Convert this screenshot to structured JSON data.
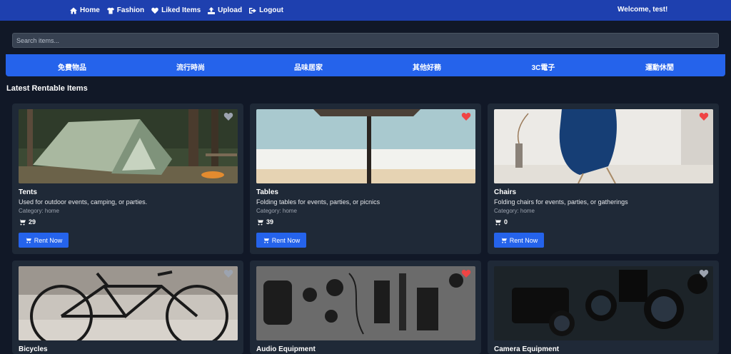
{
  "nav": {
    "links": [
      {
        "label": "Home",
        "icon": "home-icon"
      },
      {
        "label": "Fashion",
        "icon": "shirt-icon"
      },
      {
        "label": "Liked Items",
        "icon": "heart-icon"
      },
      {
        "label": "Upload",
        "icon": "upload-icon"
      },
      {
        "label": "Logout",
        "icon": "logout-icon"
      }
    ],
    "welcome": "Welcome, test!"
  },
  "search": {
    "placeholder": "Search items..."
  },
  "categories": [
    "免費物品",
    "流行時尚",
    "品味居家",
    "其他好務",
    "3C電子",
    "運動休閒"
  ],
  "section_title": "Latest Rentable Items",
  "rent_label": "Rent Now",
  "colors": {
    "nav": "#1e40af",
    "accent": "#2563eb",
    "background": "#111827",
    "card": "#1f2937",
    "liked": "#ef4444",
    "unliked": "#9ca3af"
  },
  "items": [
    {
      "title": "Tents",
      "description": "Used for outdoor events, camping, or parties.",
      "category": "Category: home",
      "count": "29",
      "liked": false
    },
    {
      "title": "Tables",
      "description": "Folding tables for events, parties, or picnics",
      "category": "Category: home",
      "count": "39",
      "liked": true
    },
    {
      "title": "Chairs",
      "description": "Folding chairs for events, parties, or gatherings",
      "category": "Category: home",
      "count": "0",
      "liked": true
    },
    {
      "title": "Bicycles",
      "liked": false
    },
    {
      "title": "Audio Equipment",
      "liked": true
    },
    {
      "title": "Camera Equipment",
      "liked": false
    }
  ]
}
